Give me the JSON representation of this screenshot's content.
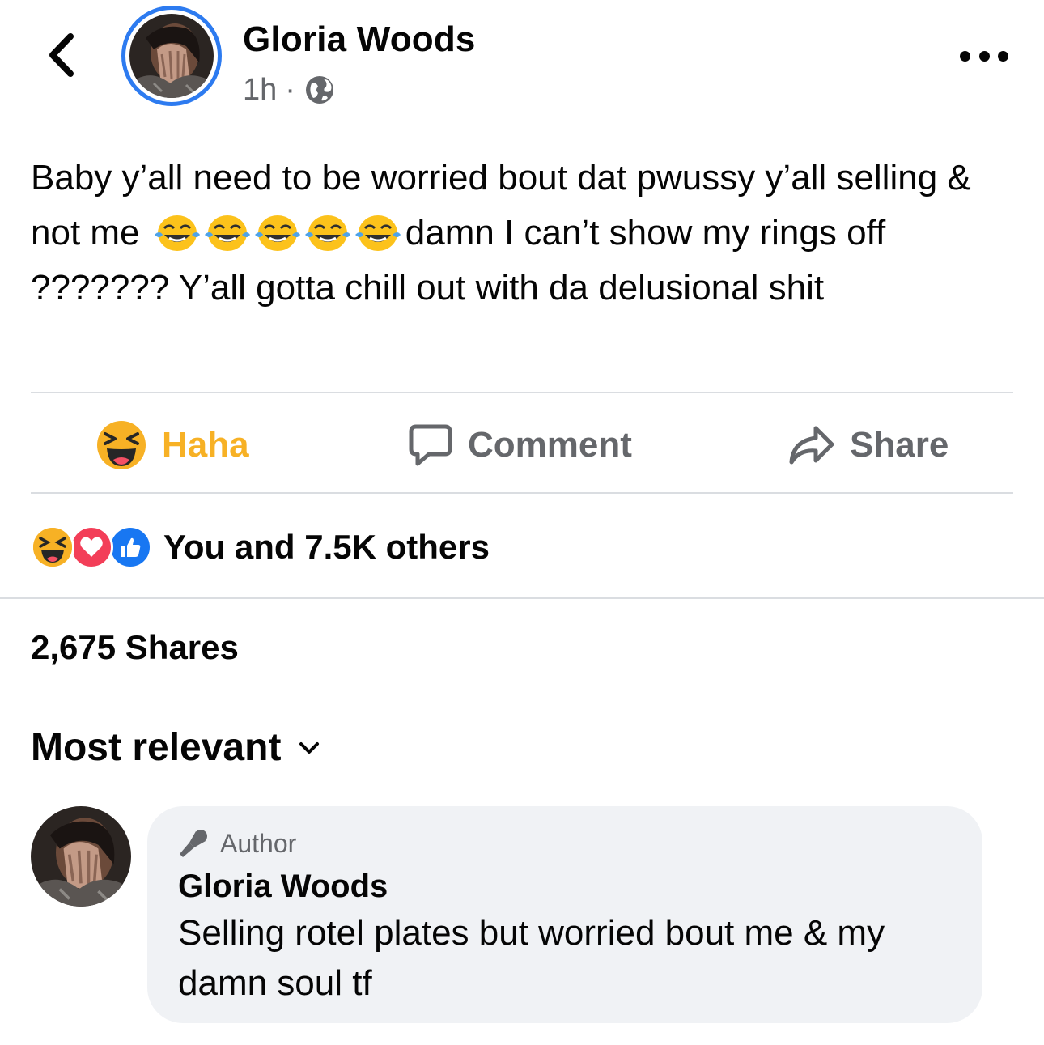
{
  "header": {
    "back_icon": "chevron-left-icon",
    "author_name": "Gloria Woods",
    "timestamp": "1h",
    "separator": "·",
    "privacy_icon": "globe-icon",
    "more_icon": "more-horizontal-icon"
  },
  "post": {
    "text_before_emoji": "Baby y’all need to be worried bout dat pwussy y’all selling & not me ",
    "emoji": [
      "😂",
      "😂",
      "😂",
      "😂",
      "😂"
    ],
    "text_after_emoji": "damn I can’t show my rings off ??????? Y’all gotta chill out with da delusional shit"
  },
  "actions": {
    "haha_label": "Haha",
    "comment_label": "Comment",
    "share_label": "Share"
  },
  "reactions": {
    "icons": [
      "haha-reaction-icon",
      "love-reaction-icon",
      "like-reaction-icon"
    ],
    "summary": "You and 7.5K others"
  },
  "shares": {
    "count_label": "2,675 Shares"
  },
  "comments": {
    "sort_label": "Most relevant",
    "items": [
      {
        "badge": "Author",
        "name": "Gloria Woods",
        "text": "Selling rotel plates but worried bout me & my damn soul tf"
      }
    ]
  },
  "colors": {
    "haha": "#f7b125",
    "love": "#f33e58",
    "like": "#1877f2",
    "secondary_text": "#65676b",
    "bubble": "#f0f2f5",
    "avatar_ring": "#2d7bf0"
  }
}
